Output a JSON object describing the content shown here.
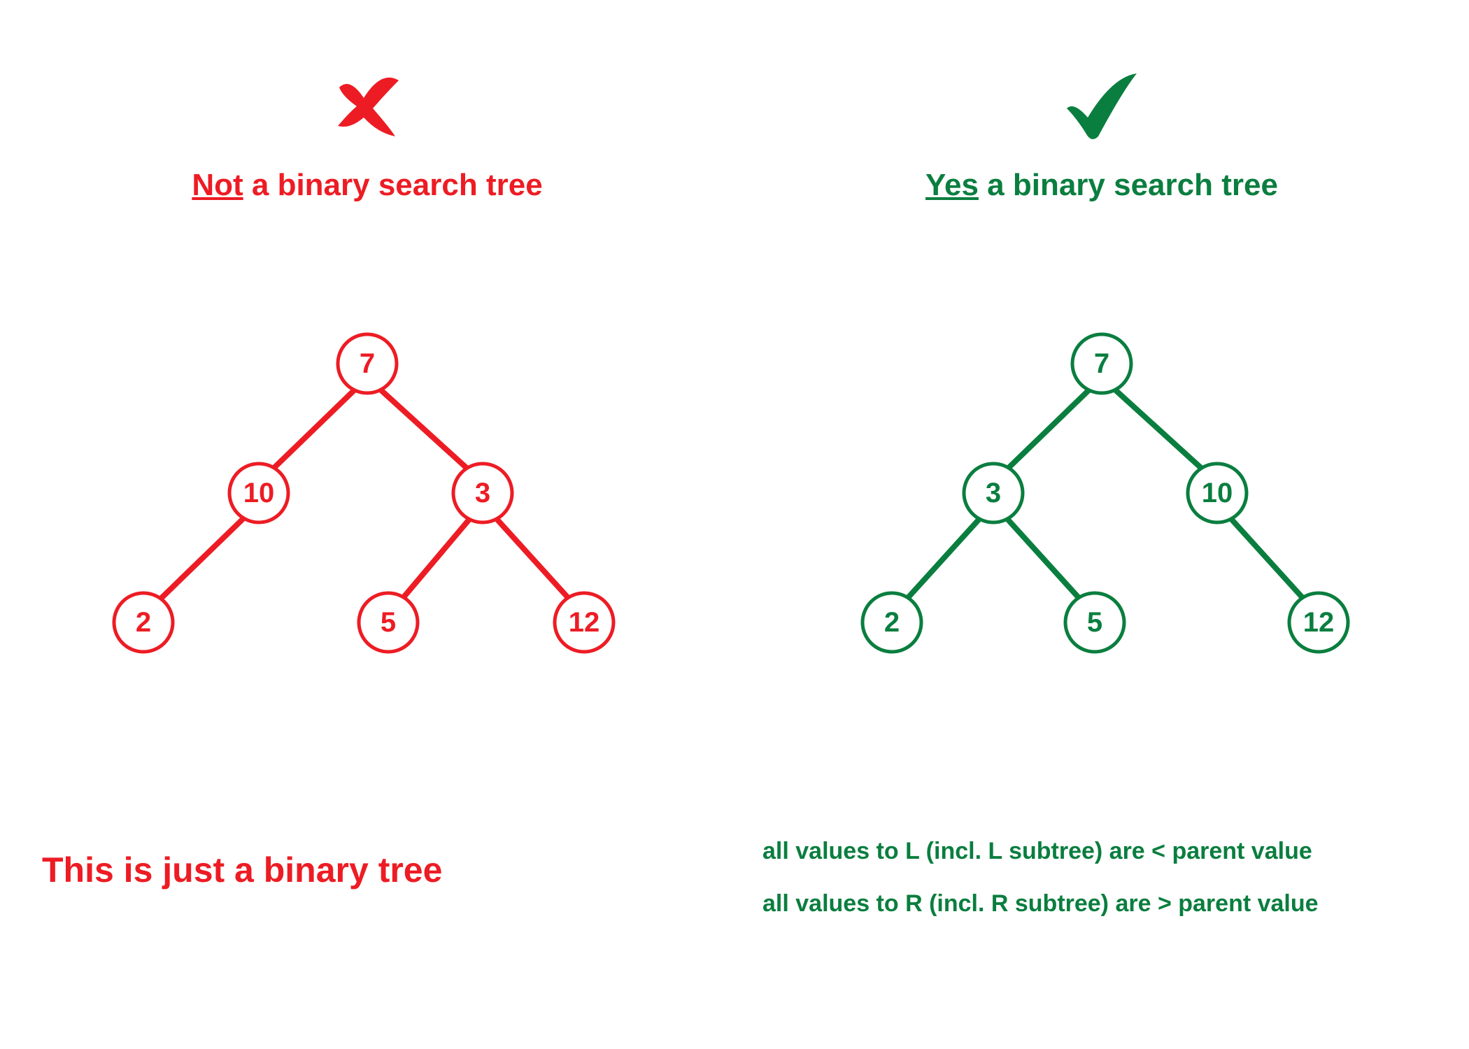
{
  "left": {
    "title_emph": "Not",
    "title_rest": " a binary search tree",
    "color": "#ed1c24",
    "tree": {
      "root": "7",
      "l": "10",
      "r": "3",
      "ll": "2",
      "rl": "5",
      "rr": "12"
    },
    "bottom": "This is just a binary tree"
  },
  "right": {
    "title_emph": "Yes",
    "title_rest": " a binary search tree",
    "color": "#0a7e3f",
    "tree": {
      "root": "7",
      "l": "3",
      "r": "10",
      "ll": "2",
      "lr": "5",
      "rr": "12"
    },
    "rule1": "all  values to L (incl.  L subtree) are < parent value",
    "rule2": "all  values to R (incl.  R subtree) are > parent value"
  }
}
